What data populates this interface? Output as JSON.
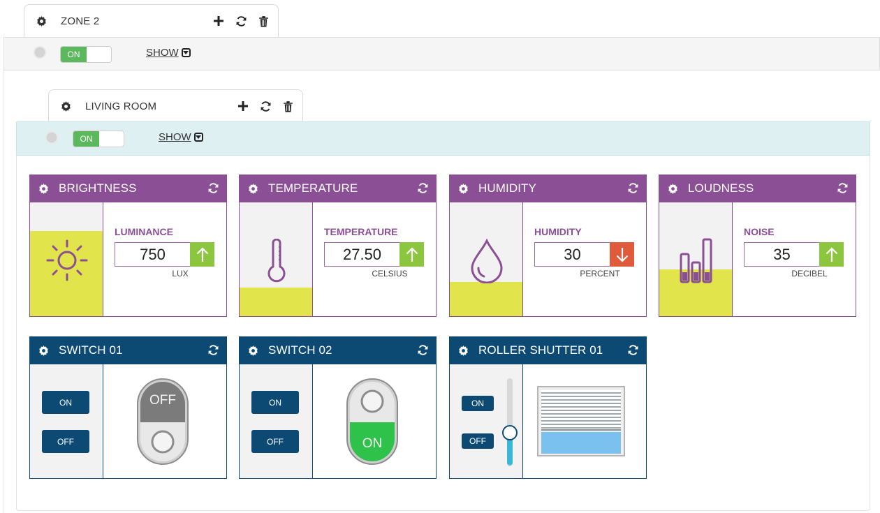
{
  "zone": {
    "tab_label": "ZONE 2",
    "toggle_on_label": "ON",
    "show_label": "SHOW"
  },
  "room": {
    "tab_label": "LIVING ROOM",
    "toggle_on_label": "ON",
    "show_label": "SHOW"
  },
  "sensors": [
    {
      "title": "BRIGHTNESS",
      "name": "LUMINANCE",
      "value": "750",
      "unit": "LUX",
      "trend": "up",
      "level": 0.75,
      "icon": "sun-icon"
    },
    {
      "title": "TEMPERATURE",
      "name": "TEMPERATURE",
      "value": "27.50",
      "unit": "CELSIUS",
      "trend": "up",
      "level": 0.25,
      "icon": "thermometer-icon"
    },
    {
      "title": "HUMIDITY",
      "name": "HUMIDITY",
      "value": "30",
      "unit": "PERCENT",
      "trend": "down",
      "level": 0.3,
      "icon": "droplet-icon"
    },
    {
      "title": "LOUDNESS",
      "name": "NOISE",
      "value": "35",
      "unit": "DECIBEL",
      "trend": "up",
      "level": 0.41,
      "icon": "volume-bars-icon"
    }
  ],
  "switches": [
    {
      "title": "SWITCH 01",
      "on_label": "ON",
      "off_label": "OFF",
      "state_label": "OFF",
      "state": "off"
    },
    {
      "title": "SWITCH 02",
      "on_label": "ON",
      "off_label": "OFF",
      "state_label": "ON",
      "state": "on"
    }
  ],
  "shutter": {
    "title": "ROLLER SHUTTER 01",
    "on_label": "ON",
    "off_label": "OFF",
    "closed_fraction": 0.6
  },
  "colors": {
    "sensor_header": "#8b4f96",
    "switch_header": "#0c4a74",
    "level_fill": "#e1e44a",
    "trend_up": "#8cc63f",
    "trend_down": "#e05a3c",
    "toggle_on": "#5cb85c",
    "room_bar": "#dff0f3"
  }
}
